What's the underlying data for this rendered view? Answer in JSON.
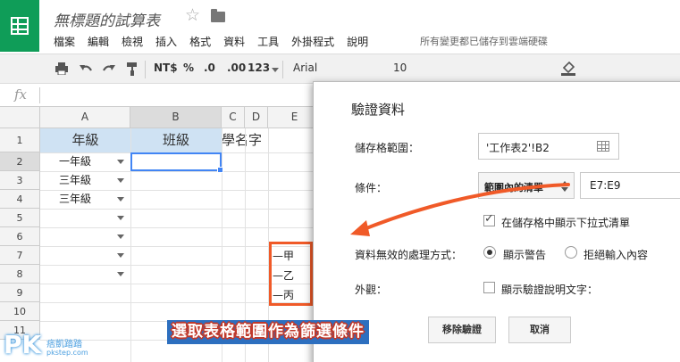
{
  "app": {
    "title": "無標題的試算表",
    "save_status": "所有變更都已儲存到雲端硬碟"
  },
  "menu": [
    "檔案",
    "編輯",
    "檢視",
    "插入",
    "格式",
    "資料",
    "工具",
    "外掛程式",
    "說明"
  ],
  "toolbar": {
    "currency": "NT$",
    "percent": "%",
    "decrease_decimal": ".0",
    "increase_decimal": ".00",
    "more_formats": "123",
    "font": "Arial",
    "font_size": "10"
  },
  "formula_bar": {
    "fx_label": "fx",
    "value": ""
  },
  "grid": {
    "columns": [
      "A",
      "B",
      "C",
      "D",
      "E"
    ],
    "rows": [
      "1",
      "2",
      "3",
      "4",
      "5",
      "6",
      "7",
      "8",
      "9",
      "10",
      "11"
    ],
    "row1": {
      "a": "年級",
      "b": "班級",
      "c": "學名字"
    },
    "col_a": [
      "一年級",
      "三年級",
      "三年級"
    ],
    "list_values": [
      "甲",
      "乙",
      "丙"
    ]
  },
  "dialog": {
    "title": "驗證資料",
    "range_label": "儲存格範圍：",
    "range_value": "'工作表2'!B2",
    "criteria_label": "條件：",
    "criteria_type": "範圍內的清單",
    "criteria_range": "E7:E9",
    "show_dropdown": "在儲存格中顯示下拉式清單",
    "invalid_label": "資料無效的處理方式：",
    "show_warning": "顯示警告",
    "reject_input": "拒絕輸入內容",
    "appearance_label": "外觀：",
    "show_help_text": "顯示驗證說明文字：",
    "remove_button": "移除驗證",
    "cancel_button": "取消"
  },
  "overlay": {
    "caption": "選取表格範圍作為篩選條件",
    "logo": "PK",
    "logo_sub": "痞凱踏踏",
    "logo_url": "pkstep.com"
  },
  "colors": {
    "sheets_green": "#0f9d58",
    "header_fill": "#cfe2f3",
    "selection_blue": "#4285f4",
    "annotation_orange": "#f05a28",
    "caption_blue": "#2d6fbf"
  }
}
